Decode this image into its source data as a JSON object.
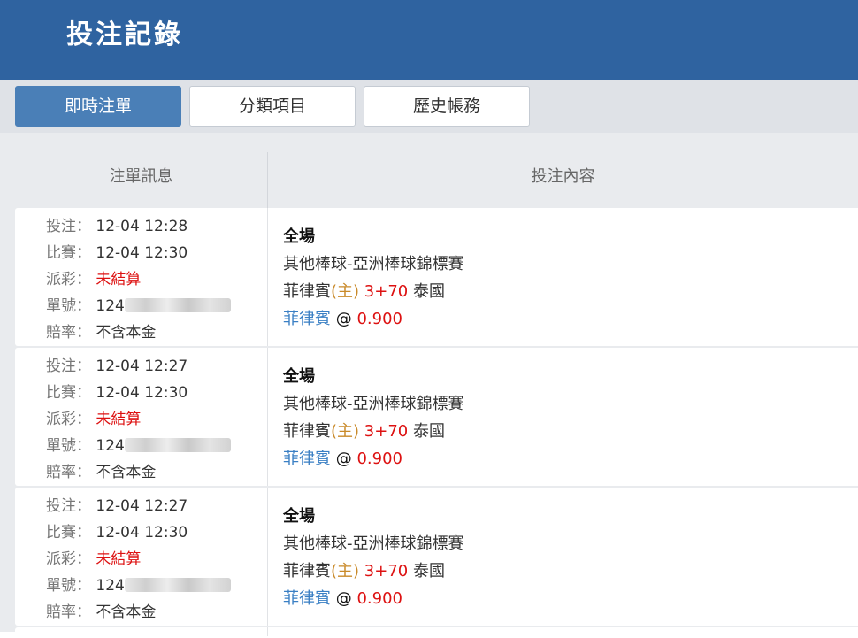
{
  "header": {
    "title": "投注記錄"
  },
  "tabs": [
    {
      "label": "即時注單",
      "active": true
    },
    {
      "label": "分類項目",
      "active": false
    },
    {
      "label": "歷史帳務",
      "active": false
    }
  ],
  "table": {
    "headers": [
      "注單訊息",
      "投注內容"
    ],
    "info_labels": {
      "bet_time": "投注：",
      "match_time": "比賽：",
      "payout": "派彩：",
      "ticket": "單號：",
      "odds_type": "賠率："
    },
    "rows": [
      {
        "bet_time": "12-04 12:28",
        "match_time": "12-04 12:30",
        "payout": "未結算",
        "ticket_prefix": "124",
        "odds_type": "不含本金",
        "period": "全場",
        "league": "其他棒球-亞洲棒球錦標賽",
        "home_team": "菲律賓",
        "home_marker": "(主)",
        "handicap": "3+70",
        "away_team": "泰國",
        "selection": "菲律賓",
        "at": "@",
        "odds": "0.900"
      },
      {
        "bet_time": "12-04 12:27",
        "match_time": "12-04 12:30",
        "payout": "未結算",
        "ticket_prefix": "124",
        "odds_type": "不含本金",
        "period": "全場",
        "league": "其他棒球-亞洲棒球錦標賽",
        "home_team": "菲律賓",
        "home_marker": "(主)",
        "handicap": "3+70",
        "away_team": "泰國",
        "selection": "菲律賓",
        "at": "@",
        "odds": "0.900"
      },
      {
        "bet_time": "12-04 12:27",
        "match_time": "12-04 12:30",
        "payout": "未結算",
        "ticket_prefix": "124",
        "odds_type": "不含本金",
        "period": "全場",
        "league": "其他棒球-亞洲棒球錦標賽",
        "home_team": "菲律賓",
        "home_marker": "(主)",
        "handicap": "3+70",
        "away_team": "泰國",
        "selection": "菲律賓",
        "at": "@",
        "odds": "0.900"
      }
    ]
  },
  "colors": {
    "header_bg": "#2f63a0",
    "active_tab": "#4a7fb7",
    "payout_pending": "#dd1111",
    "team_link": "#3a7fc4",
    "home_marker": "#c98a2a"
  }
}
